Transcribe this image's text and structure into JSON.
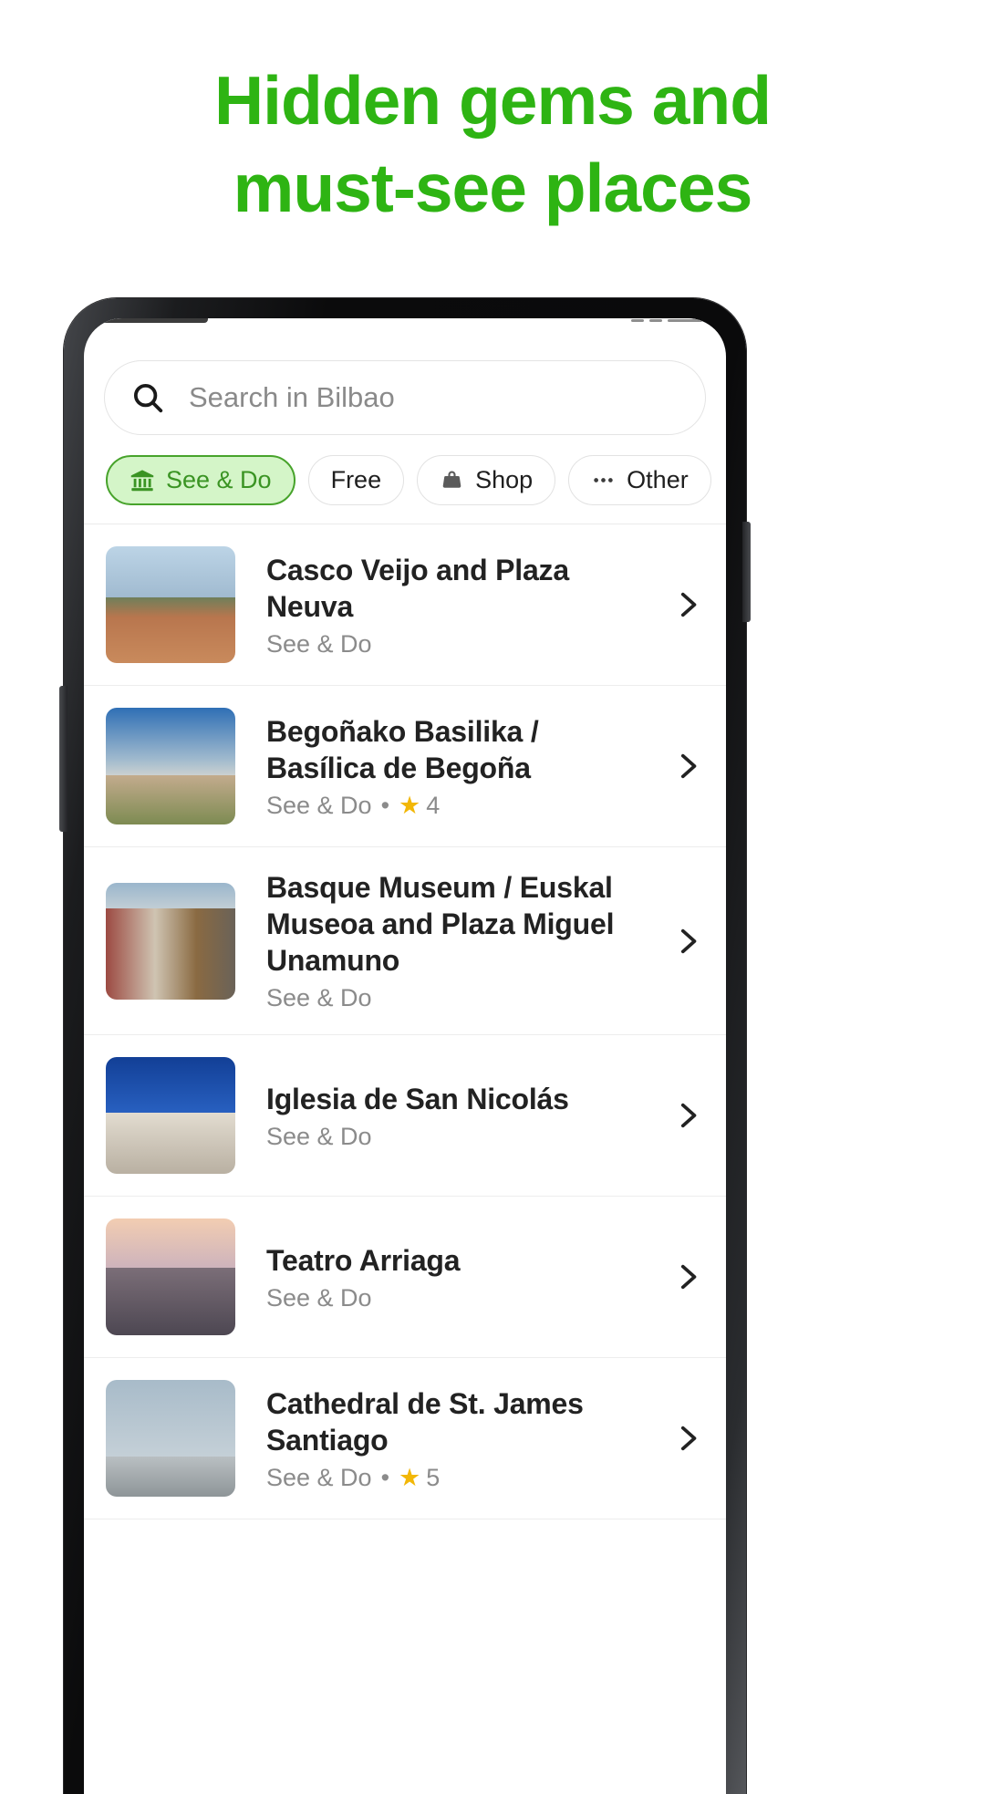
{
  "headline": {
    "line1": "Hidden gems and",
    "line2": "must-see places"
  },
  "search": {
    "placeholder": "Search in Bilbao",
    "icon": "search-icon"
  },
  "filters": [
    {
      "label": "See & Do",
      "icon": "museum-icon",
      "selected": true
    },
    {
      "label": "Free",
      "icon": "",
      "selected": false
    },
    {
      "label": "Shop",
      "icon": "bag-icon",
      "selected": false
    },
    {
      "label": "Other",
      "icon": "ellipsis-icon",
      "selected": false
    }
  ],
  "places": [
    {
      "title": "Casco Veijo and Plaza Neuva",
      "category": "See & Do",
      "rating": "",
      "chevron": "chevron-right-icon"
    },
    {
      "title": "Begoñako Basilika / Basílica de Begoña",
      "category": "See & Do",
      "rating": "4",
      "chevron": "chevron-right-icon"
    },
    {
      "title": "Basque Museum / Euskal Museoa and Plaza Miguel Unamuno",
      "category": "See & Do",
      "rating": "",
      "chevron": "chevron-right-icon"
    },
    {
      "title": "Iglesia de San Nicolás",
      "category": "See & Do",
      "rating": "",
      "chevron": "chevron-right-icon"
    },
    {
      "title": "Teatro Arriaga",
      "category": "See & Do",
      "rating": "",
      "chevron": "chevron-right-icon"
    },
    {
      "title": "Cathedral de St. James Santiago",
      "category": "See & Do",
      "rating": "5",
      "chevron": "chevron-right-icon"
    }
  ],
  "colors": {
    "headline_green": "#2eb413",
    "chip_selected_bg": "#d4f5c8",
    "chip_selected_border": "#47a32b",
    "chip_selected_text": "#3a9423",
    "star_yellow": "#f2b707",
    "title_text": "#222222",
    "sub_text": "#8b8b8b"
  }
}
